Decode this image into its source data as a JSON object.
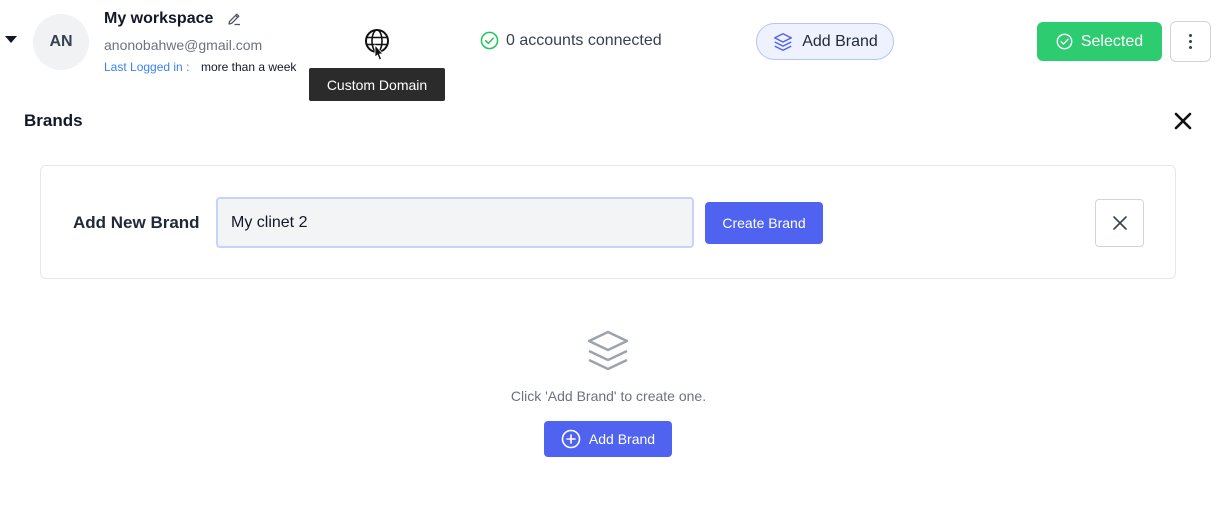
{
  "workspace": {
    "avatar_initials": "AN",
    "name": "My workspace",
    "email": "anonobahwe@gmail.com",
    "last_logged_label": "Last Logged in :",
    "last_logged_value": "more than a week"
  },
  "tooltip": {
    "text": "Custom Domain"
  },
  "accounts": {
    "text": "0 accounts connected"
  },
  "top_actions": {
    "add_brand_label": "Add Brand",
    "selected_label": "Selected"
  },
  "brands": {
    "title": "Brands",
    "form": {
      "label": "Add New Brand",
      "input_value": "My clinet 2",
      "create_label": "Create Brand"
    },
    "empty_text": "Click 'Add Brand' to create one.",
    "add_brand_label": "Add Brand"
  },
  "colors": {
    "accent": "#4f63f0",
    "success": "#2ecc71",
    "link": "#3b82f6"
  },
  "icons": [
    "chevron-down-icon",
    "edit-icon",
    "globe-icon",
    "check-circle-icon",
    "layers-icon",
    "more-vertical-icon",
    "close-icon",
    "plus-circle-icon"
  ]
}
